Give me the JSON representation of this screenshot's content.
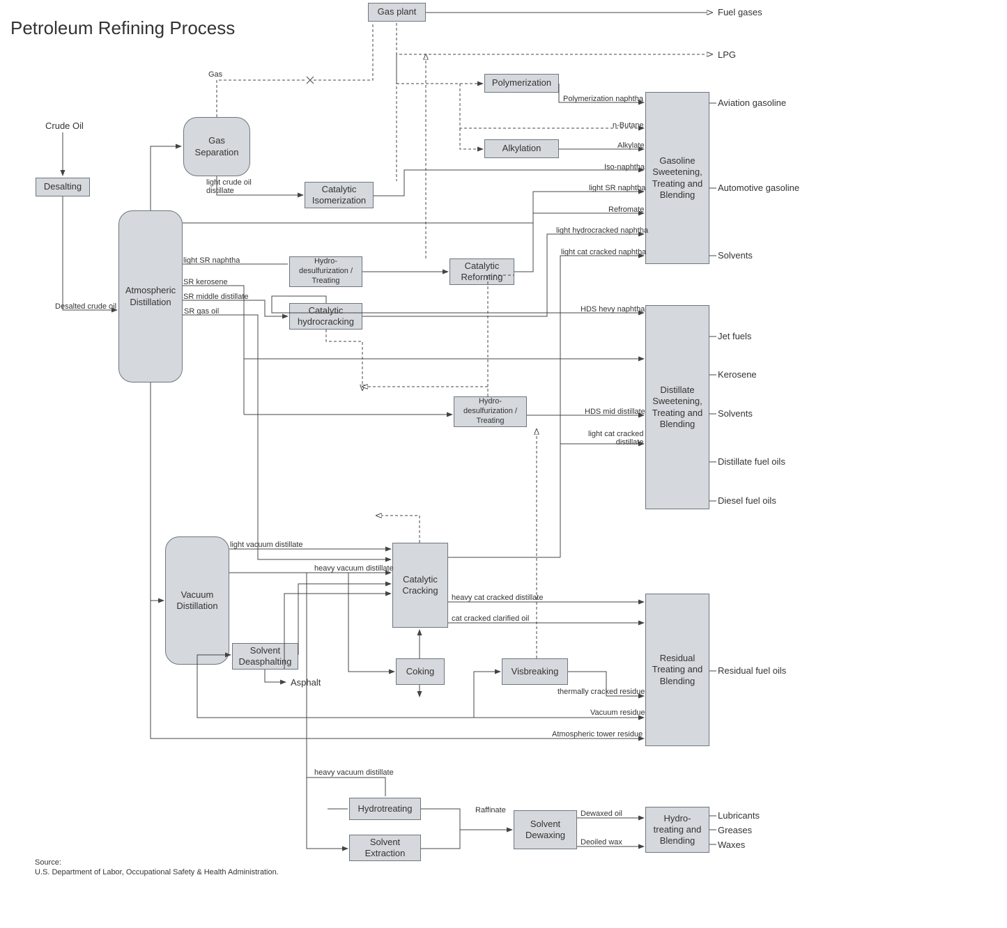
{
  "title": "Petroleum Refining Process",
  "input": "Crude Oil",
  "source_label": "Source:",
  "source_text": "U.S. Department of Labor, Occupational Safety & Health Administration.",
  "boxes": {
    "desalting": "Desalting",
    "gas_sep": "Gas\nSeparation",
    "gas_plant": "Gas plant",
    "atm_dist": "Atmospheric\nDistillation",
    "cat_iso": "Catalytic\nIsomerization",
    "hydro_desulf1": "Hydro-\ndesulfurization /\nTreating",
    "cat_reform": "Catalytic\nReforming",
    "cat_hydro": "Catalytic\nhydrocracking",
    "hydro_desulf2": "Hydro-\ndesulfurization /\nTreating",
    "polymer": "Polymerization",
    "alkyl": "Alkylation",
    "gas_sweet": "Gasoline\nSweetening,\nTreating and\nBlending",
    "dist_sweet": "Distillate\nSweetening,\nTreating and\nBlending",
    "vac_dist": "Vacuum\nDistillation",
    "solv_deasph": "Solvent\nDeasphalting",
    "cat_crack": "Catalytic\nCracking",
    "coking": "Coking",
    "visbreak": "Visbreaking",
    "resid": "Residual\nTreating and\nBlending",
    "hydrotreat": "Hydrotreating",
    "solv_ext": "Solvent\nExtraction",
    "solv_dewax": "Solvent\nDewaxing",
    "hydro_blend": "Hydro-\ntreating and\nBlending"
  },
  "labels": {
    "gas": "Gas",
    "light_crude": "light crude oil\ndistillate",
    "desalted": "Desalted crude oil",
    "light_sr_naphtha": "light SR naphtha",
    "sr_kero": "SR kerosene",
    "sr_mid": "SR middle distillate",
    "sr_gas_oil": "SR gas oil",
    "poly_naph": "Polymerization naphtha",
    "n_butane": "n-Butane",
    "alkylate": "Alkylate",
    "iso_naph": "Iso-naphtha",
    "light_sr_naph2": "light SR naphtha",
    "refromate": "Refromate",
    "light_hydro_naph": "light hydrocracked naphtha",
    "light_cat_naph": "light cat cracked naphtha",
    "hds_hevy": "HDS hevy naphtha",
    "hds_mid": "HDS mid distillate",
    "light_cat_dist": "light cat cracked\ndistillate",
    "light_vac": "light vacuum distillate",
    "heavy_vac": "heavy vacuum distillate",
    "heavy_vac2": "heavy vacuum distillate",
    "heavy_cat_dist": "heavy cat cracked distillate",
    "cat_clar": "cat cracked clarified oil",
    "therm_resid": "thermally cracked residue",
    "vac_resid": "Vacuum residue",
    "atm_resid": "Atmospheric tower residue",
    "asphalt": "Asphalt",
    "raffinate": "Raffinate",
    "dewaxed": "Dewaxed oil",
    "deoiled": "Deoiled wax"
  },
  "outputs": {
    "fuel_gases": "Fuel gases",
    "lpg": "LPG",
    "av_gas": "Aviation gasoline",
    "auto_gas": "Automotive gasoline",
    "solvents1": "Solvents",
    "jet": "Jet fuels",
    "kerosene": "Kerosene",
    "solvents2": "Solvents",
    "dist_fuel": "Distillate fuel oils",
    "diesel": "Diesel fuel oils",
    "resid_fuel": "Residual fuel oils",
    "lubricants": "Lubricants",
    "greases": "Greases",
    "waxes": "Waxes"
  }
}
